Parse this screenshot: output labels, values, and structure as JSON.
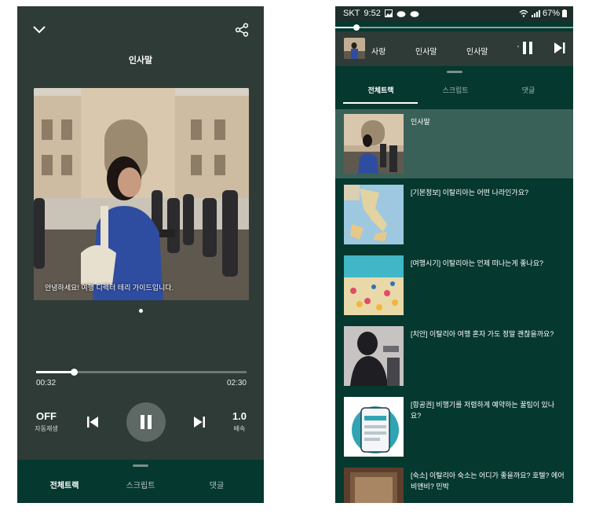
{
  "left": {
    "track_title": "인사말",
    "caption": "안녕하세요! 여행 디렉터 테리 가이드입니다.",
    "elapsed": "00:32",
    "duration": "02:30",
    "progress_fraction": 0.18,
    "autoplay_value": "OFF",
    "autoplay_label": "자동재생",
    "speed_value": "1.0",
    "speed_label": "배속",
    "tabs": [
      "전체트랙",
      "스크립트",
      "댓글"
    ]
  },
  "right": {
    "status": {
      "carrier": "SKT",
      "time": "9:52",
      "battery": "67%"
    },
    "mini_progress_fraction": 0.09,
    "mini_ticker": [
      "사랑",
      "인사말",
      "인사말",
      "'"
    ],
    "tabs": [
      "전체트랙",
      "스크립트",
      "댓글"
    ],
    "tracks": [
      {
        "title": "인사말",
        "active": true
      },
      {
        "title": "[기본정보] 이탈리아는 어떤 나라인가요?",
        "active": false
      },
      {
        "title": "[여행시기] 이탈리아는 언제 떠나는게 좋나요?",
        "active": false
      },
      {
        "title": "[치안] 이탈리아 여행 혼자 가도 정말 괜찮을까요?",
        "active": false
      },
      {
        "title": "[항공권] 비행기를 저렴하게 예약하는 꿀팁이 있나요?",
        "active": false
      },
      {
        "title": "[숙소] 이탈리아 숙소는 어디가 좋을까요? 호텔? 에어비앤비? 민박",
        "active": false
      }
    ]
  },
  "colors": {
    "player_bg": "#2e3b37",
    "list_bg": "#05382f",
    "active_row": "#3a6158"
  }
}
